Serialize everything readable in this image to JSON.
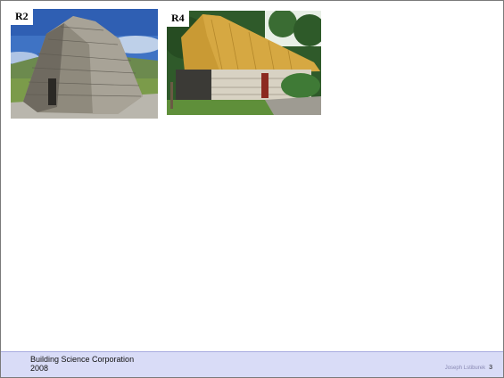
{
  "photos": [
    {
      "label": "R2",
      "subject": "stone-beehive-structure"
    },
    {
      "label": "R4",
      "subject": "thatched-stone-cottage"
    }
  ],
  "footer": {
    "organization": "Building Science Corporation",
    "year": "2008",
    "author": "Joseph Lstiburek",
    "page_number": "3"
  },
  "colors": {
    "footer_background": "#d9dcf7",
    "slide_border": "#7a7a7a"
  }
}
